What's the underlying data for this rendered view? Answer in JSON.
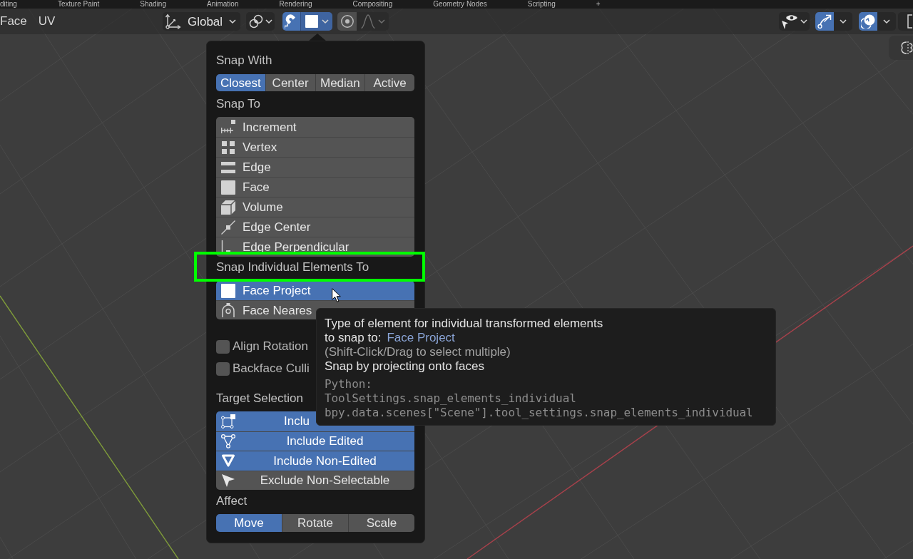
{
  "workspace_tabs": [
    "diting",
    "Texture Paint",
    "Shading",
    "Animation",
    "Rendering",
    "Compositing",
    "Geometry Nodes",
    "Scripting",
    "+"
  ],
  "header": {
    "menus": [
      "Face",
      "UV"
    ],
    "orientation": "Global",
    "snap": {
      "on": true
    },
    "proportional_editing": {
      "on": false
    },
    "falloff": {
      "disabled": true
    },
    "gizmos": {
      "on": true
    },
    "overlays": {
      "on": true
    }
  },
  "popover": {
    "snap_with": {
      "title": "Snap With",
      "options": [
        {
          "label": "Closest",
          "selected": true
        },
        {
          "label": "Center",
          "selected": false
        },
        {
          "label": "Median",
          "selected": false
        },
        {
          "label": "Active",
          "selected": false
        }
      ]
    },
    "snap_to": {
      "title": "Snap To",
      "items": [
        {
          "label": "Increment",
          "selected": false
        },
        {
          "label": "Vertex",
          "selected": false
        },
        {
          "label": "Edge",
          "selected": false
        },
        {
          "label": "Face",
          "selected": false
        },
        {
          "label": "Volume",
          "selected": false
        },
        {
          "label": "Edge Center",
          "selected": false
        },
        {
          "label": "Edge Perpendicular",
          "selected": false
        }
      ]
    },
    "snap_individual": {
      "title": "Snap Individual Elements To",
      "items": [
        {
          "label": "Face Project",
          "selected": true
        },
        {
          "label": "Face Neares",
          "selected": false
        }
      ]
    },
    "options": [
      {
        "label": "Align Rotation",
        "checked": false
      },
      {
        "label": "Backface Culli",
        "checked": false
      }
    ],
    "target_selection": {
      "title": "Target Selection",
      "items": [
        {
          "label": "Inclu",
          "selected": true,
          "covered": true
        },
        {
          "label": "Include Edited",
          "selected": true,
          "covered": false
        },
        {
          "label": "Include Non-Edited",
          "selected": true,
          "covered": false
        },
        {
          "label": "Exclude Non-Selectable",
          "selected": false,
          "covered": false
        }
      ]
    },
    "affect": {
      "title": "Affect",
      "options": [
        {
          "label": "Move",
          "selected": true
        },
        {
          "label": "Rotate",
          "selected": false
        },
        {
          "label": "Scale",
          "selected": false
        }
      ]
    }
  },
  "tooltip": {
    "lines": [
      {
        "kind": "text",
        "text": "Type of element for individual transformed elements"
      },
      {
        "kind": "field",
        "label": "to snap to:",
        "value": "Face Project"
      },
      {
        "kind": "hint",
        "text": "(Shift-Click/Drag to select multiple)"
      },
      {
        "kind": "text",
        "text": "Snap by projecting onto faces"
      }
    ],
    "python": [
      "Python:",
      "ToolSettings.snap_elements_individual",
      "bpy.data.scenes[\"Scene\"].tool_settings.snap_elements_individual"
    ]
  }
}
